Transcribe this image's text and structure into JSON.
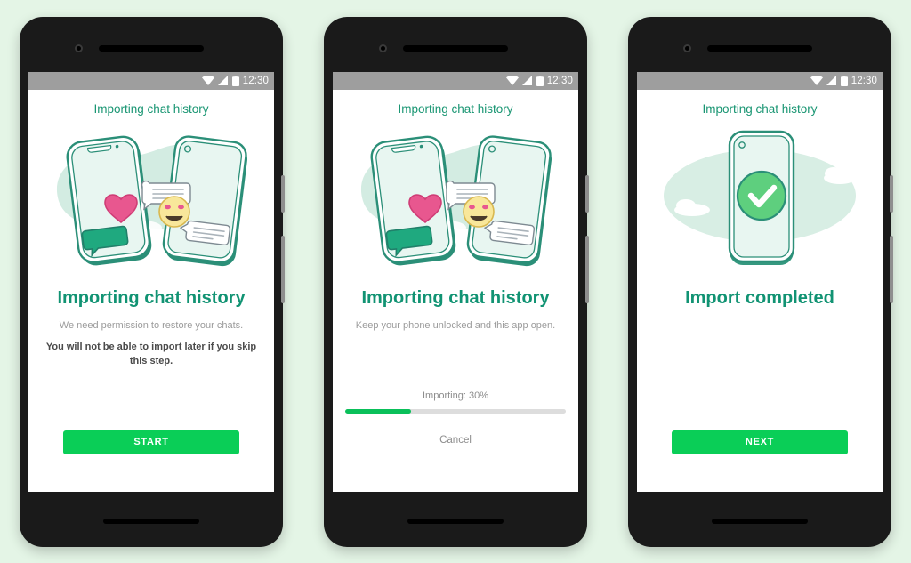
{
  "page": {
    "background_color": "#e4f5e6",
    "accent_green": "#0ace57",
    "heading_color": "#119373"
  },
  "status_bar": {
    "time": "12:30",
    "icons": [
      "wifi-icon",
      "signal-icon",
      "battery-icon"
    ]
  },
  "screens": [
    {
      "id": "permission",
      "appbar_title": "Importing chat history",
      "illustration": "two-phones-chat-transfer-illustration",
      "headline": "Importing chat history",
      "subtitle": "We need permission to restore your chats.",
      "warning": "You will not be able to import later if you skip this step.",
      "button_label": "START"
    },
    {
      "id": "in-progress",
      "appbar_title": "Importing chat history",
      "illustration": "two-phones-chat-transfer-illustration",
      "headline": "Importing chat history",
      "subtitle": "Keep your phone unlocked and this app open.",
      "progress_label": "Importing: 30%",
      "progress_percent": 30,
      "cancel_label": "Cancel"
    },
    {
      "id": "completed",
      "appbar_title": "Importing chat history",
      "illustration": "phone-with-green-checkmark-illustration",
      "headline": "Import completed",
      "button_label": "NEXT"
    }
  ]
}
